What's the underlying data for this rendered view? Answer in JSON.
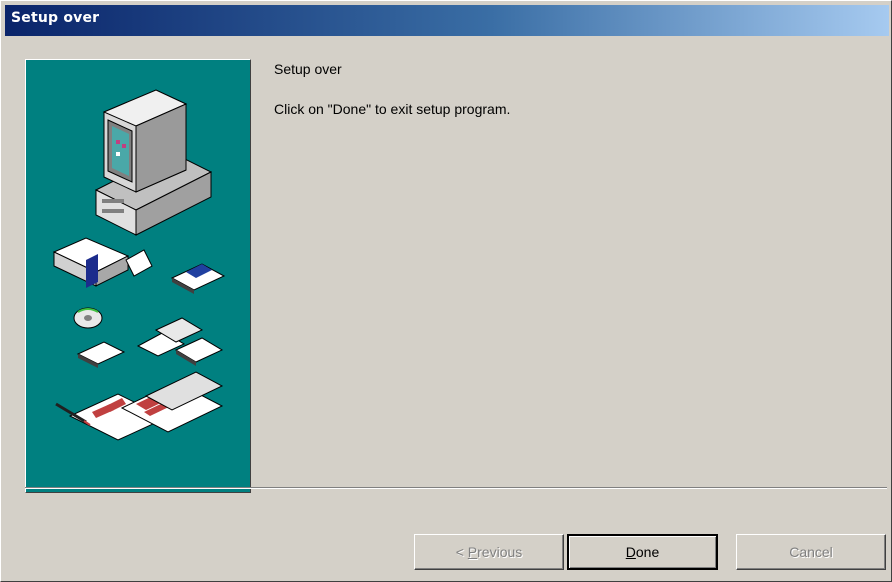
{
  "window": {
    "title": "Setup over"
  },
  "content": {
    "heading": "Setup over",
    "message": "Click on \"Done\" to exit setup program."
  },
  "buttons": {
    "previous": {
      "mnemonic": "P",
      "rest": "revious",
      "prefix": "< ",
      "enabled": false
    },
    "done": {
      "mnemonic": "D",
      "rest": "one",
      "enabled": true,
      "default": true
    },
    "cancel": {
      "label": "Cancel",
      "enabled": false
    }
  },
  "colors": {
    "title_start": "#0a246a",
    "title_end": "#a6caf0",
    "panel": "#008080",
    "face": "#d4d0c8"
  },
  "icons": [
    "computer-icon",
    "software-box-icon",
    "floppy-disk-icon",
    "cd-rom-icon",
    "documents-icon",
    "pen-icon"
  ]
}
